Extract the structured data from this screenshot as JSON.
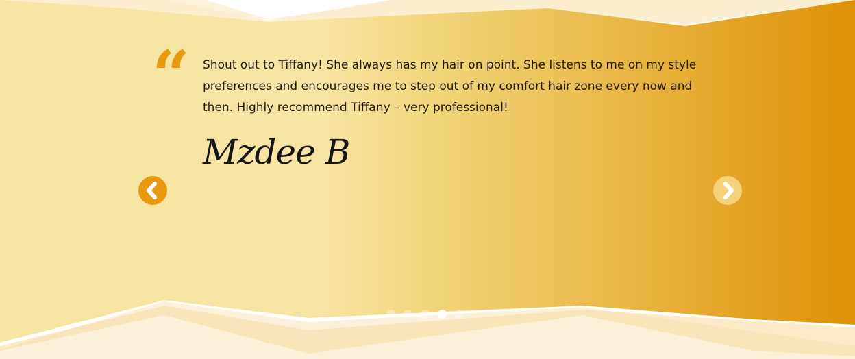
{
  "colors": {
    "band_left": "#f6e4a2",
    "band_mid": "#f2d67c",
    "band_right": "#df9104",
    "accent": "#e8990e",
    "text": "#1e1a14"
  },
  "testimonial": {
    "quote_icon": "“",
    "text": "Shout out to Tiffany! She always has my hair on point. She listens to me on my style preferences and encourages me to step out of my comfort hair zone every now and then.  Highly recommend Tiffany – very professional!",
    "author": "Mzdee B"
  },
  "navigation": {
    "prev_icon": "chevron-left-icon",
    "next_icon": "chevron-right-icon"
  },
  "pagination": {
    "count": 5,
    "active_index": 3
  }
}
